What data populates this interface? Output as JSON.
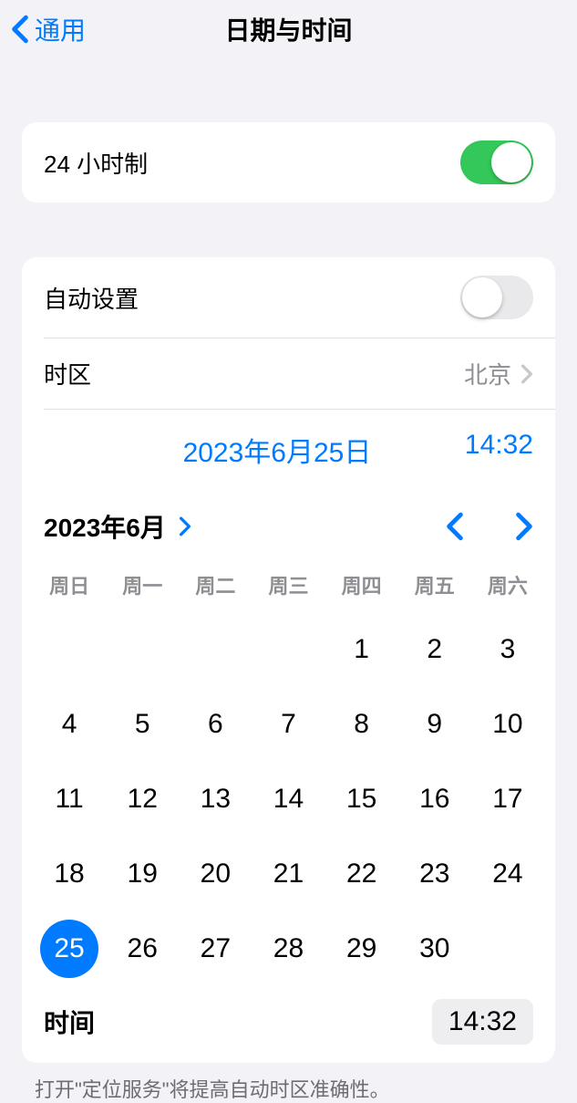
{
  "nav": {
    "back_label": "通用",
    "title": "日期与时间"
  },
  "section1": {
    "clock24_label": "24 小时制",
    "clock24_on": true
  },
  "section2": {
    "autoset_label": "自动设置",
    "autoset_on": false,
    "timezone_label": "时区",
    "timezone_value": "北京",
    "selected_date_display": "2023年6月25日",
    "selected_time_display": "14:32",
    "month_label": "2023年6月",
    "weekdays": [
      "周日",
      "周一",
      "周二",
      "周三",
      "周四",
      "周五",
      "周六"
    ],
    "calendar": {
      "first_weekday_index": 4,
      "days_in_month": 30,
      "selected_day": 25
    },
    "time_row_label": "时间",
    "time_row_value": "14:32"
  },
  "footer_note": "打开\"定位服务\"将提高自动时区准确性。"
}
